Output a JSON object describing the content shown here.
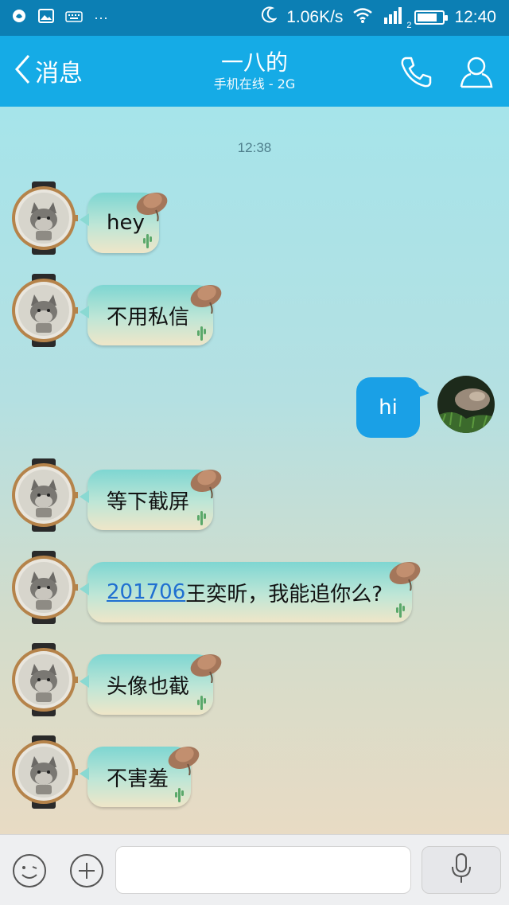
{
  "status_bar": {
    "speed": "1.06K/s",
    "network_badge": "2",
    "time": "12:40",
    "battery_level": 0.8,
    "icons": [
      "app-icon",
      "image-icon",
      "keyboard-icon",
      "more-icon",
      "moon-icon",
      "wifi-icon",
      "signal-icon",
      "battery-icon"
    ]
  },
  "header": {
    "back_label": "消息",
    "contact_name": "一八的",
    "contact_status": "手机在线 - 2G",
    "icons": [
      "back-chevron-icon",
      "phone-icon",
      "contact-profile-icon"
    ],
    "accent": "#15abe6"
  },
  "chat": {
    "timestamp": "12:38",
    "messages": [
      {
        "from": "contact",
        "text": "hey"
      },
      {
        "from": "contact",
        "text": "不用私信"
      },
      {
        "from": "me",
        "text": "hi"
      },
      {
        "from": "contact",
        "text": "等下截屏"
      },
      {
        "from": "contact",
        "link": "201706",
        "text": "王奕昕，我能追你么?"
      },
      {
        "from": "contact",
        "text": "头像也截"
      },
      {
        "from": "contact",
        "text": "不害羞"
      }
    ]
  },
  "input_bar": {
    "placeholder": "",
    "icons": [
      "emoji-icon",
      "plus-icon",
      "microphone-icon"
    ]
  }
}
